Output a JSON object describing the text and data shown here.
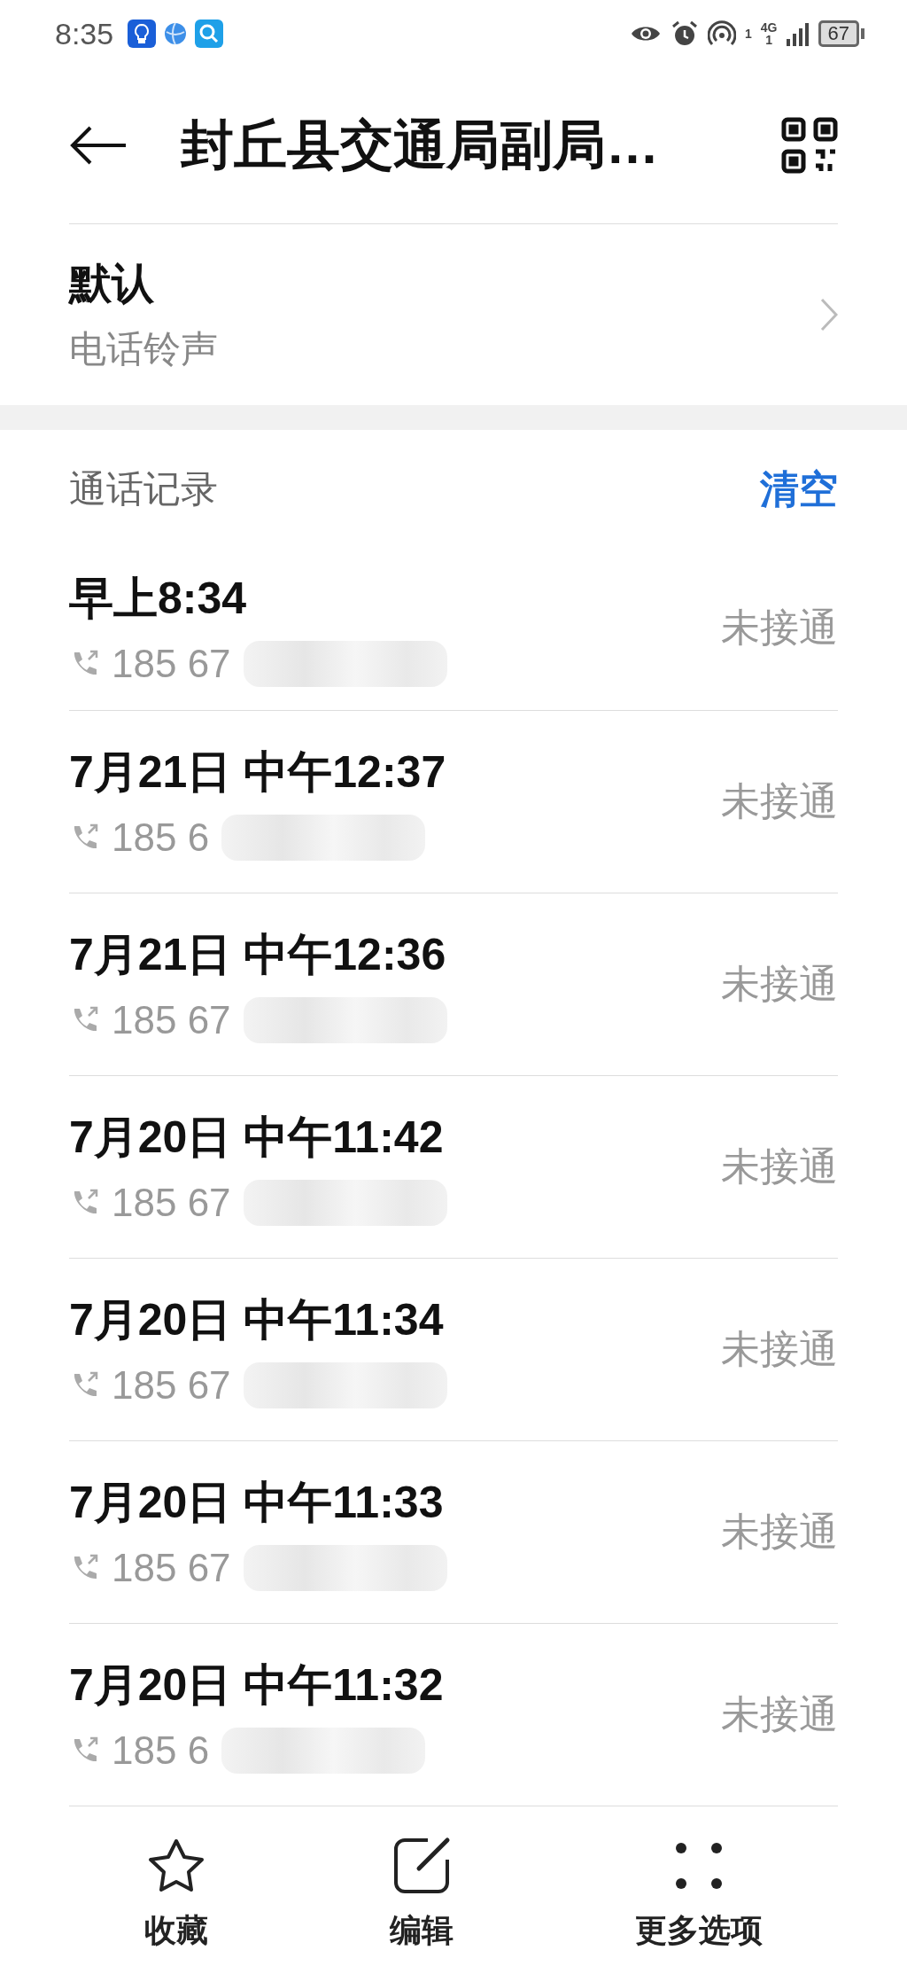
{
  "status_bar": {
    "time": "8:35",
    "hotspot_count": "1",
    "network": "4G",
    "sim": "1",
    "battery": "67"
  },
  "header": {
    "title": "封丘县交通局副局…"
  },
  "ringtone": {
    "value": "默认",
    "label": "电话铃声"
  },
  "call_log": {
    "title": "通话记录",
    "clear_button": "清空",
    "calls": [
      {
        "time": "早上8:34",
        "number": "185 67",
        "status": "未接通"
      },
      {
        "time": "7月21日 中午12:37",
        "number": "185 6",
        "status": "未接通"
      },
      {
        "time": "7月21日 中午12:36",
        "number": "185 67",
        "status": "未接通"
      },
      {
        "time": "7月20日 中午11:42",
        "number": "185 67",
        "status": "未接通"
      },
      {
        "time": "7月20日 中午11:34",
        "number": "185 67",
        "status": "未接通"
      },
      {
        "time": "7月20日 中午11:33",
        "number": "185 67",
        "status": "未接通"
      },
      {
        "time": "7月20日 中午11:32",
        "number": "185 6",
        "status": "未接通"
      }
    ]
  },
  "bottom_bar": [
    {
      "kind": "star",
      "label": "收藏"
    },
    {
      "kind": "edit",
      "label": "编辑"
    },
    {
      "kind": "more",
      "label": "更多选项"
    }
  ]
}
